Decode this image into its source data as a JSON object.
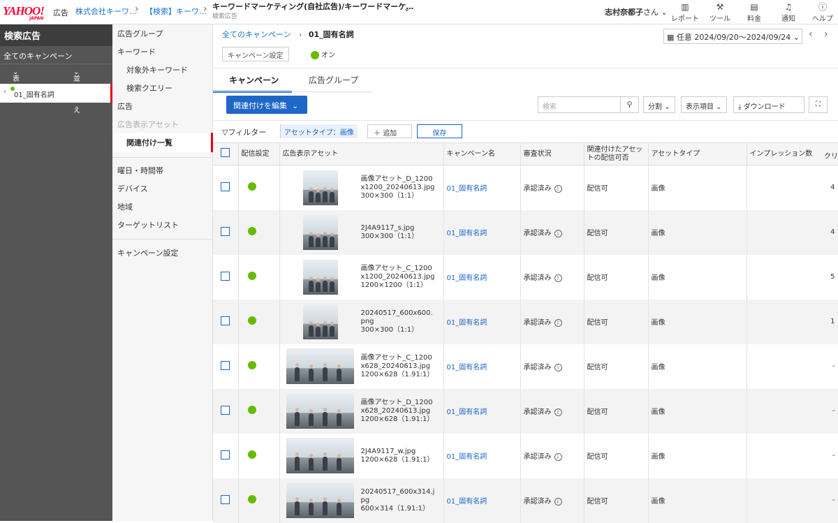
{
  "header": {
    "logo_text": "YAHOO!",
    "logo_sub": "JAPAN",
    "logo_ad": "広告",
    "breadcrumb": [
      "株式会社キーワ…",
      "【検索】キーワ…"
    ],
    "campaign_title": "キーワードマーケティング(自社広告)/キーワードマーケ…",
    "campaign_sub": "検索広告",
    "user_name": "志村奈都子",
    "user_suffix": "さん",
    "nav": [
      {
        "label": "レポート",
        "icon": "chart-icon"
      },
      {
        "label": "ツール",
        "icon": "wrench-icon"
      },
      {
        "label": "料金",
        "icon": "wallet-icon"
      },
      {
        "label": "通知",
        "icon": "bell-icon"
      },
      {
        "label": "ヘルプ",
        "icon": "help-icon"
      }
    ]
  },
  "leftnav": {
    "title": "検索広告",
    "all_campaigns": "全てのキャンペーン",
    "filter": "表示：全て",
    "sort": "並べ替え",
    "campaign": "01_固有名詞"
  },
  "subnav": {
    "items": [
      "広告グループ",
      "キーワード",
      "対象外キーワード",
      "検索クエリー",
      "広告",
      "広告表示アセット",
      "関連付け一覧",
      "曜日・時間帯",
      "デバイス",
      "地域",
      "ターゲットリスト",
      "キャンペーン設定"
    ]
  },
  "main": {
    "breadcrumb_root": "全てのキャンペーン",
    "breadcrumb_current": "01_固有名詞",
    "campaign_settings": "キャンペーン設定",
    "status": "オン",
    "date_range": "任意 2024/09/20〜2024/09/24",
    "tabs": [
      "キャンペーン",
      "広告グループ"
    ],
    "assoc_button": "関連付けを編集",
    "search_placeholder": "検索",
    "split": "分割",
    "columns_btn": "表示項目",
    "download": "ダウンロード",
    "filter_label": "フィルター",
    "filter_chip": "アセットタイプ：画像",
    "add": "追加",
    "save": "保存",
    "headers": [
      "配信設定",
      "広告表示アセット",
      "キャンペーン名",
      "審査状況",
      "関連付けたアセットの配信可否",
      "アセットタイプ",
      "インプレッション数",
      "クリ"
    ],
    "rows": [
      {
        "name": "画像アセット_D_1200x1200_20240613.jpg",
        "size": "300×300（1:1）",
        "campaign": "01_固有名詞",
        "review": "承認済み",
        "deliver": "配信可",
        "type": "画像",
        "imps": "4",
        "shape": "sq"
      },
      {
        "name": "2J4A9117_s.jpg",
        "size": "300×300（1:1）",
        "campaign": "01_固有名詞",
        "review": "承認済み",
        "deliver": "配信可",
        "type": "画像",
        "imps": "4",
        "shape": "sq"
      },
      {
        "name": "画像アセット_C_1200x1200_20240613.jpg",
        "size": "1200×1200（1:1）",
        "campaign": "01_固有名詞",
        "review": "承認済み",
        "deliver": "配信可",
        "type": "画像",
        "imps": "5",
        "shape": "sq"
      },
      {
        "name": "20240517_600x600.png",
        "size": "300×300（1:1）",
        "campaign": "01_固有名詞",
        "review": "承認済み",
        "deliver": "配信可",
        "type": "画像",
        "imps": "1",
        "shape": "sq"
      },
      {
        "name": "画像アセット_C_1200x628_20240613.jpg",
        "size": "1200×628（1.91:1）",
        "campaign": "01_固有名詞",
        "review": "承認済み",
        "deliver": "配信可",
        "type": "画像",
        "imps": "-",
        "shape": "wide"
      },
      {
        "name": "画像アセット_D_1200x628_20240613.jpg",
        "size": "1200×628（1.91:1）",
        "campaign": "01_固有名詞",
        "review": "承認済み",
        "deliver": "配信可",
        "type": "画像",
        "imps": "-",
        "shape": "wide"
      },
      {
        "name": "2J4A9117_w.jpg",
        "size": "1200×628（1.91:1）",
        "campaign": "01_固有名詞",
        "review": "承認済み",
        "deliver": "配信可",
        "type": "画像",
        "imps": "-",
        "shape": "wide"
      },
      {
        "name": "20240517_600x314.jpg",
        "size": "600×314（1.91:1）",
        "campaign": "01_固有名詞",
        "review": "承認済み",
        "deliver": "配信可",
        "type": "画像",
        "imps": "-",
        "shape": "wide"
      }
    ]
  },
  "colors": {
    "accent": "#1e66c8",
    "active_bar": "#e60012",
    "status_green": "#66bb00"
  }
}
